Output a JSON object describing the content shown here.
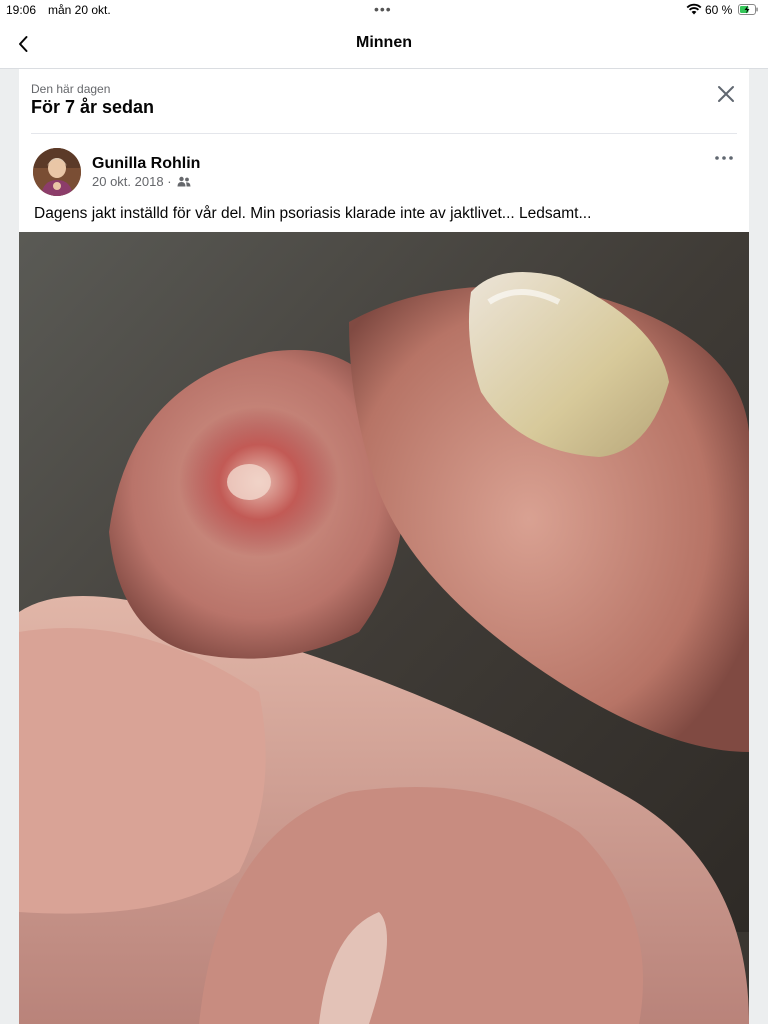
{
  "status_bar": {
    "time": "19:06",
    "date": "mån 20 okt.",
    "battery_percent": "60 %",
    "battery_level": 0.6,
    "icons": [
      "multitask-dots-icon",
      "wifi-icon",
      "battery-charging-icon"
    ]
  },
  "nav": {
    "title": "Minnen",
    "back_icon": "chevron-left-icon"
  },
  "memory": {
    "eyebrow": "Den här dagen",
    "heading": "För 7 år sedan",
    "close_icon": "close-icon"
  },
  "post": {
    "author": "Gunilla Rohlin",
    "date": "20 okt. 2018",
    "separator": "·",
    "audience_icon": "friends-icon",
    "more_icon": "more-dots-icon",
    "text": "Dagens jakt inställd för vår del. Min psoriasis klarade inte av jaktlivet... Ledsamt..."
  },
  "colors": {
    "background": "#eceeef",
    "card": "#ffffff",
    "secondary_text": "#65676b",
    "primary_text": "#050505"
  }
}
